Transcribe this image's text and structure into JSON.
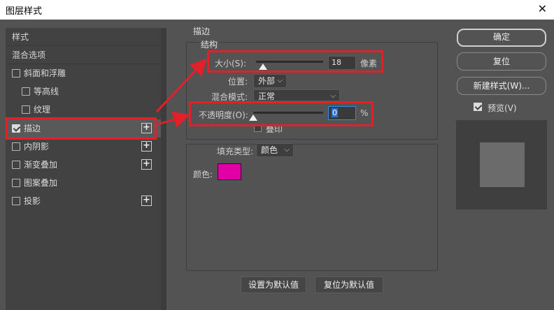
{
  "window": {
    "title": "图层样式",
    "close_glyph": "✕"
  },
  "sidebar": {
    "items": [
      {
        "label": "样式",
        "has_checkbox": false,
        "checked": false,
        "has_plus": false
      },
      {
        "label": "混合选项",
        "has_checkbox": false,
        "checked": false,
        "has_plus": false
      },
      {
        "label": "斜面和浮雕",
        "has_checkbox": true,
        "checked": false,
        "has_plus": false
      },
      {
        "label": "等高线",
        "has_checkbox": true,
        "checked": false,
        "has_plus": false
      },
      {
        "label": "纹理",
        "has_checkbox": true,
        "checked": false,
        "has_plus": false
      },
      {
        "label": "描边",
        "has_checkbox": true,
        "checked": true,
        "has_plus": true,
        "selected": true
      },
      {
        "label": "内阴影",
        "has_checkbox": true,
        "checked": false,
        "has_plus": true
      },
      {
        "label": "渐变叠加",
        "has_checkbox": true,
        "checked": false,
        "has_plus": true
      },
      {
        "label": "图案叠加",
        "has_checkbox": true,
        "checked": false,
        "has_plus": false
      },
      {
        "label": "投影",
        "has_checkbox": true,
        "checked": false,
        "has_plus": true
      }
    ]
  },
  "stroke": {
    "section_title": "描边",
    "structure_title": "结构",
    "size": {
      "label": "大小(S):",
      "value": "18",
      "unit": "像素",
      "slider_fraction": 0.1
    },
    "position": {
      "label": "位置:",
      "value": "外部"
    },
    "blend_mode": {
      "label": "混合模式:",
      "value": "正常"
    },
    "opacity": {
      "label": "不透明度(O):",
      "value": "0",
      "unit": "%",
      "slider_fraction": 0.0
    },
    "overprint": {
      "label": "叠印",
      "checked": false
    },
    "fill_type": {
      "label": "填充类型:",
      "value": "颜色"
    },
    "color": {
      "label": "颜色:",
      "value": "#e000a6"
    },
    "buttons": {
      "set_default": "设置为默认值",
      "reset_default": "复位为默认值"
    }
  },
  "actions": {
    "ok": "确定",
    "reset": "复位",
    "new_style": "新建样式(W)...",
    "preview_label": "预览(V)",
    "preview_checked": true
  },
  "annotation_color": "#e3202a"
}
